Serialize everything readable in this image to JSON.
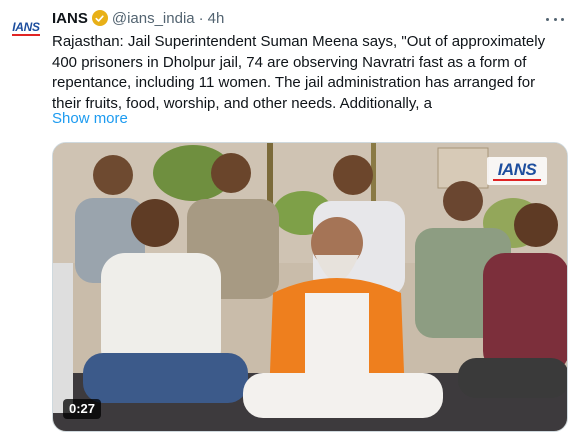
{
  "tweet": {
    "avatar_logo": "IANS",
    "display_name": "IANS",
    "verified_badge_color": "#e8b017",
    "handle": "@ians_india",
    "separator": "·",
    "time": "4h",
    "text": "Rajasthan: Jail Superintendent Suman Meena says, \"Out of approximately 400 prisoners in Dholpur jail, 74 are observing Navratri fast as a form of repentance, including 11 women. The jail administration has arranged for their fruits, food, worship, and other needs. Additionally, a",
    "show_more": "Show more",
    "more_icon": "ellipsis-icon"
  },
  "media": {
    "type": "video",
    "watermark": "IANS",
    "duration": "0:27"
  },
  "colors": {
    "link": "#1d9bf0",
    "secondary_text": "#536471",
    "brand_blue": "#1d4e9e",
    "brand_red": "#e02424"
  }
}
